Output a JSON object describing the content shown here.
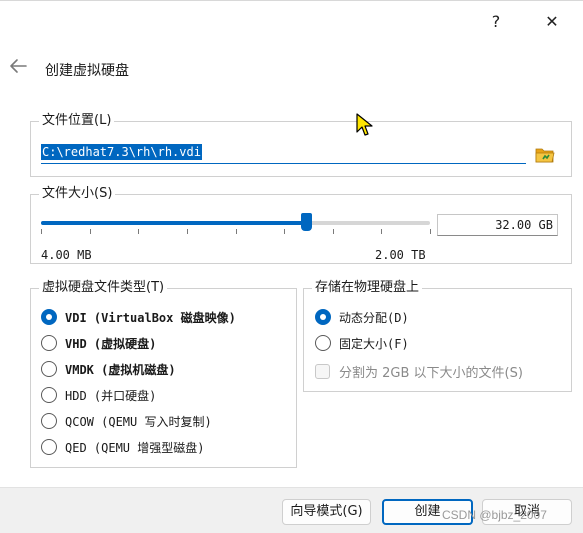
{
  "window": {
    "help_label": "?",
    "close_label": "✕"
  },
  "header": {
    "title": "创建虚拟硬盘",
    "back_icon": "arrow-left-icon"
  },
  "location": {
    "legend": "文件位置(L)",
    "path": "C:\\redhat7.3\\rh\\rh.vdi",
    "folder_icon": "folder-icon"
  },
  "size": {
    "legend": "文件大小(S)",
    "value": "32.00 GB",
    "min_label": "4.00 MB",
    "max_label": "2.00 TB",
    "slider_fraction": 0.68
  },
  "type": {
    "legend": "虚拟硬盘文件类型(T)",
    "options": [
      {
        "label": "VDI (VirtualBox 磁盘映像)",
        "checked": true,
        "bold": true
      },
      {
        "label": "VHD (虚拟硬盘)",
        "checked": false,
        "bold": true
      },
      {
        "label": "VMDK (虚拟机磁盘)",
        "checked": false,
        "bold": true
      },
      {
        "label": "HDD (并口硬盘)",
        "checked": false,
        "bold": false
      },
      {
        "label": "QCOW (QEMU 写入时复制)",
        "checked": false,
        "bold": false
      },
      {
        "label": "QED (QEMU 增强型磁盘)",
        "checked": false,
        "bold": false
      }
    ]
  },
  "storage": {
    "legend": "存储在物理硬盘上",
    "options": [
      {
        "label": "动态分配(D)",
        "checked": true
      },
      {
        "label": "固定大小(F)",
        "checked": false
      }
    ],
    "split_label": "分割为 2GB 以下大小的文件(S)"
  },
  "footer": {
    "expert_label": "向导模式(G)",
    "create_label": "创建",
    "cancel_label": "取消"
  },
  "watermark": "CSDN @bjbz_2007",
  "colors": {
    "accent": "#0067c0",
    "folder": "#e8a317"
  }
}
